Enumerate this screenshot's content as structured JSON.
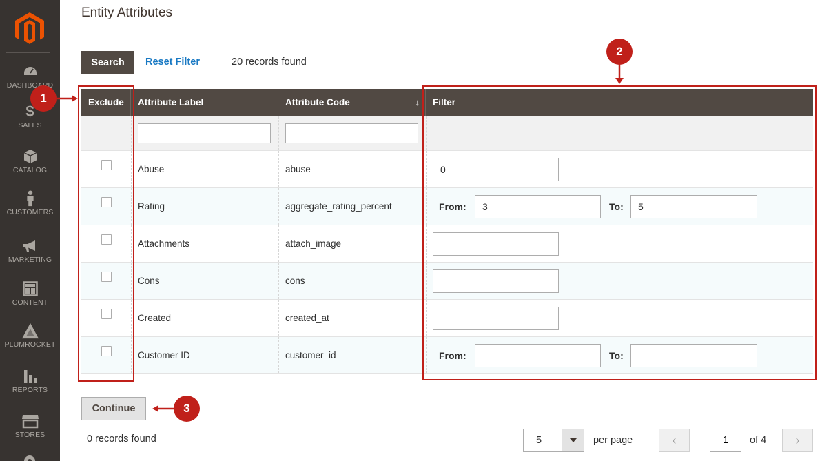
{
  "sidebar": {
    "items": [
      {
        "label": "DASHBOARD",
        "icon": "dashboard-icon"
      },
      {
        "label": "SALES",
        "icon": "dollar-icon"
      },
      {
        "label": "CATALOG",
        "icon": "box-icon"
      },
      {
        "label": "CUSTOMERS",
        "icon": "person-icon"
      },
      {
        "label": "MARKETING",
        "icon": "megaphone-icon"
      },
      {
        "label": "CONTENT",
        "icon": "layout-icon"
      },
      {
        "label": "PLUMROCKET",
        "icon": "plumrocket-icon"
      },
      {
        "label": "REPORTS",
        "icon": "bar-chart-icon"
      },
      {
        "label": "STORES",
        "icon": "store-icon"
      }
    ]
  },
  "page": {
    "title": "Entity Attributes"
  },
  "toolbar": {
    "search_label": "Search",
    "reset_label": "Reset Filter",
    "records_found": "20 records found"
  },
  "grid": {
    "columns": [
      "Exclude",
      "Attribute Label",
      "Attribute Code",
      "Filter"
    ],
    "sort_indicator": "↓",
    "rows": [
      {
        "label": "Abuse",
        "code": "abuse",
        "filter_type": "text",
        "value": "0"
      },
      {
        "label": "Rating",
        "code": "aggregate_rating_percent",
        "filter_type": "range",
        "from": "3",
        "to": "5"
      },
      {
        "label": "Attachments",
        "code": "attach_image",
        "filter_type": "text",
        "value": ""
      },
      {
        "label": "Cons",
        "code": "cons",
        "filter_type": "text",
        "value": ""
      },
      {
        "label": "Created",
        "code": "created_at",
        "filter_type": "text",
        "value": ""
      },
      {
        "label": "Customer ID",
        "code": "customer_id",
        "filter_type": "range",
        "from": "",
        "to": ""
      }
    ],
    "from_label": "From:",
    "to_label": "To:"
  },
  "annotations": [
    "1",
    "2",
    "3"
  ],
  "footer": {
    "continue_label": "Continue",
    "records_found": "0 records found",
    "per_page_value": "5",
    "per_page_label": "per page",
    "current_page": "1",
    "total_pages": "of 4",
    "prev_icon": "‹",
    "next_icon": "›"
  },
  "colors": {
    "sidebar_bg": "#373330",
    "header_bg": "#514943",
    "link": "#1979c3",
    "annotation": "#c0201a",
    "logo": "#eb5202"
  }
}
